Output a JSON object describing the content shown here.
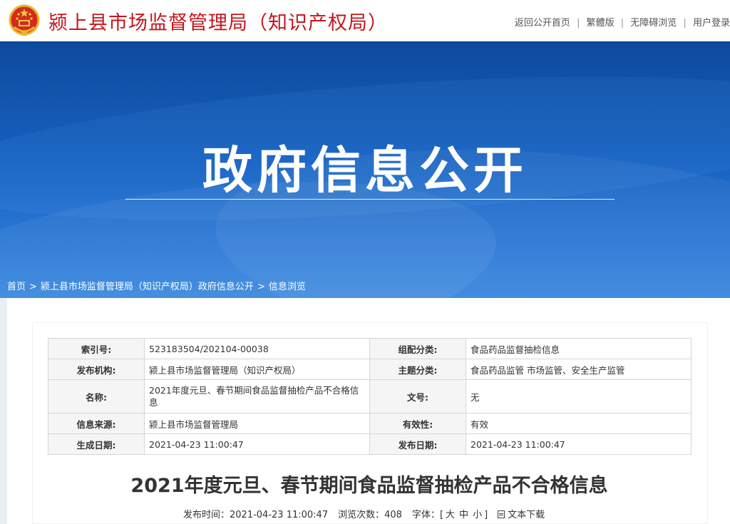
{
  "header": {
    "site_title": "颍上县市场监督管理局（知识产权局）",
    "links": [
      "返回公开首页",
      "繁體版",
      "无障碍浏览",
      "用户登录"
    ]
  },
  "banner": {
    "title": "政府信息公开"
  },
  "breadcrumb": {
    "items": [
      "首页",
      "颍上县市场监督管理局（知识产权局）政府信息公开",
      "信息浏览"
    ],
    "separator": ">"
  },
  "meta_table": {
    "rows": [
      {
        "k1": "索引号:",
        "v1": "523183504/202104-00038",
        "k2": "组配分类:",
        "v2": "食品药品监督抽检信息"
      },
      {
        "k1": "发布机构:",
        "v1": "颍上县市场监督管理局（知识产权局）",
        "k2": "主题分类:",
        "v2": "食品药品监管  市场监管、安全生产监管"
      },
      {
        "k1": "名称:",
        "v1": "2021年度元旦、春节期间食品监督抽检产品不合格信息",
        "k2": "文号:",
        "v2": "无"
      },
      {
        "k1": "信息来源:",
        "v1": "颍上县市场监督管理局",
        "k2": "有效性:",
        "v2": "有效"
      },
      {
        "k1": "生成日期:",
        "v1": "2021-04-23 11:00:47",
        "k2": "发布日期:",
        "v2": "2021-04-23 11:00:47"
      }
    ]
  },
  "article": {
    "title": "2021年度元旦、春节期间食品监督抽检产品不合格信息",
    "publish_label": "发布时间：",
    "publish_time": "2021-04-23 11:00:47",
    "views_label": "浏览次数：",
    "views": "408",
    "font_label": "字体：",
    "font_open": "[",
    "font_sizes": [
      "大",
      "中",
      "小"
    ],
    "font_close": "]",
    "download_label": "文本下载"
  },
  "colors": {
    "brand_red": "#c4161c",
    "banner_blue": "#1660c0"
  }
}
